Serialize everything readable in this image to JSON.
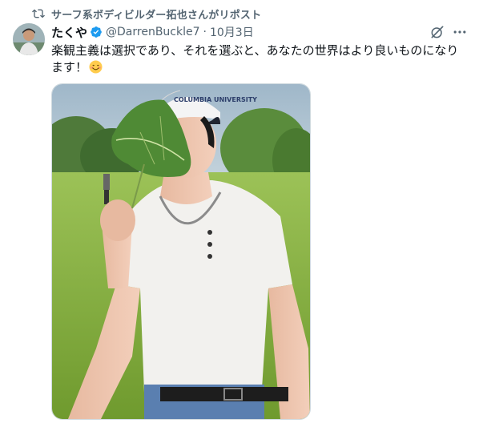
{
  "repost": {
    "text": "サーフ系ボディビルダー拓也さんがリポスト",
    "icon": "repost-icon"
  },
  "tweet": {
    "author_name": "たくや",
    "verified": true,
    "handle": "@DarrenBuckle7",
    "separator": "·",
    "date": "10月3日",
    "text": "楽観主義は選択であり、それを選ぶと、あなたの世界はより良いものになります！",
    "emoji": "smiling-face-emoji",
    "media": {
      "cap_text": "COLUMBIA UNIVERSITY"
    }
  },
  "colors": {
    "primary_text": "#0f1419",
    "secondary_text": "#536471",
    "verified_blue": "#1d9bf0",
    "border": "#cfd9de"
  }
}
